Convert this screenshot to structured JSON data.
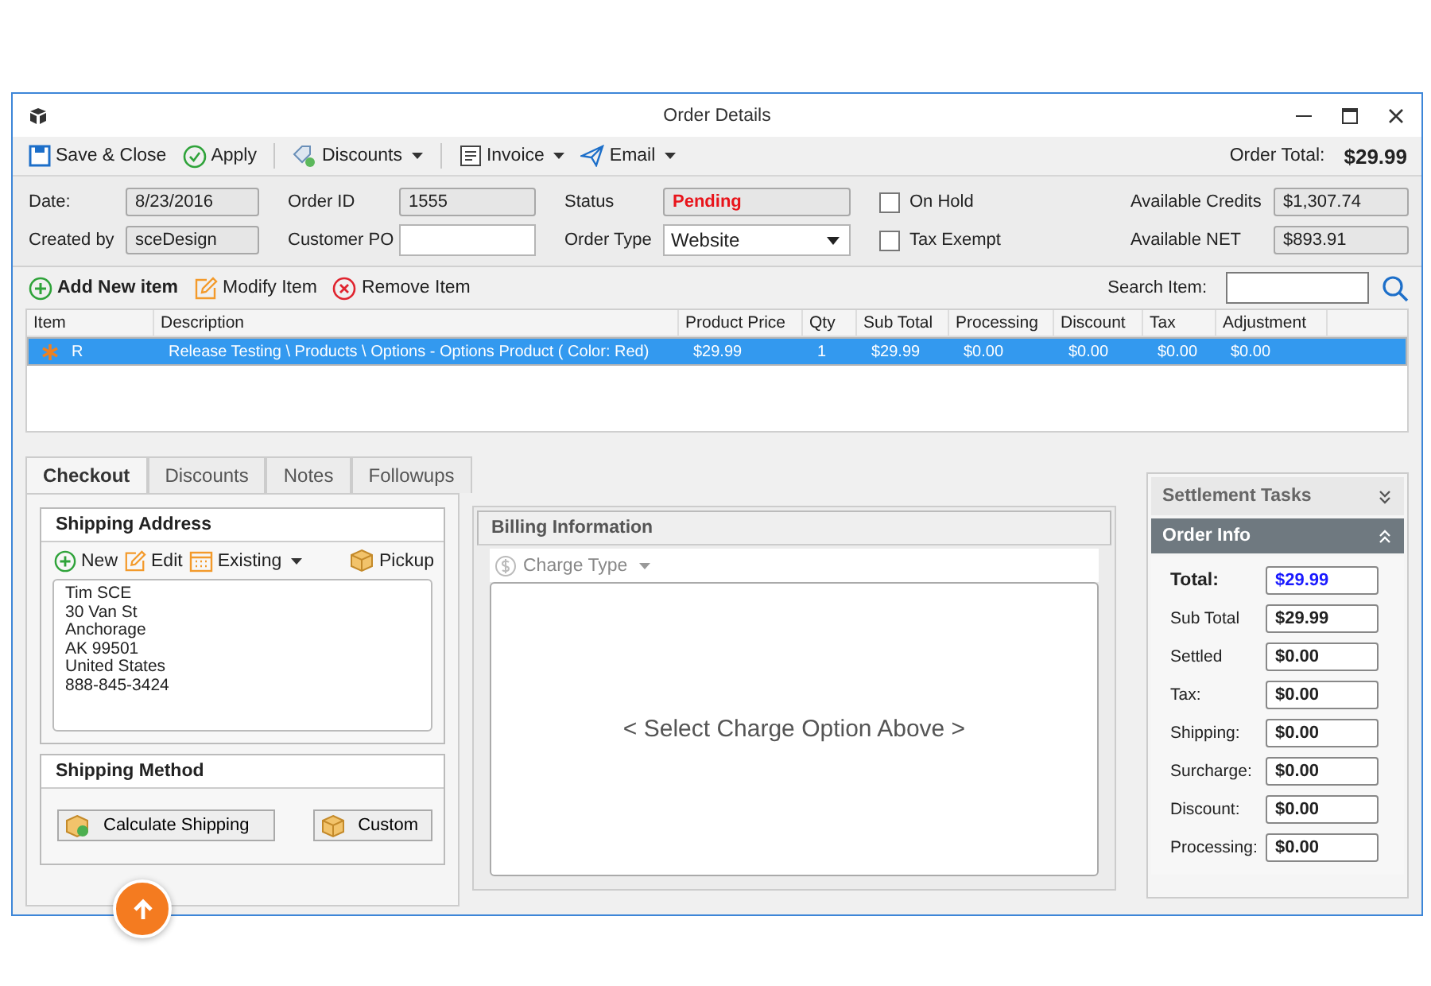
{
  "window": {
    "title": "Order Details"
  },
  "toolbar": {
    "save_close": "Save & Close",
    "apply": "Apply",
    "discounts": "Discounts",
    "invoice": "Invoice",
    "email": "Email",
    "order_total_label": "Order Total:",
    "order_total": "$29.99"
  },
  "header": {
    "date_label": "Date:",
    "date": "8/23/2016",
    "created_by_label": "Created by",
    "created_by": "sceDesign",
    "order_id_label": "Order ID",
    "order_id": "1555",
    "customer_po_label": "Customer PO",
    "status_label": "Status",
    "status": "Pending",
    "order_type_label": "Order Type",
    "order_type": "Website",
    "on_hold": {
      "label": "On Hold",
      "checked": false
    },
    "tax_exempt": {
      "label": "Tax Exempt",
      "checked": false
    },
    "credits_label": "Available Credits",
    "credits": "$1,307.74",
    "net_label": "Available NET",
    "net": "$893.91"
  },
  "items_toolbar": {
    "add": "Add New item",
    "modify": "Modify Item",
    "remove": "Remove Item",
    "search_label": "Search Item:"
  },
  "table": {
    "columns": [
      "Item",
      "Description",
      "Product Price",
      "Qty",
      "Sub Total",
      "Processing",
      "Discount",
      "Tax",
      "Adjustment"
    ],
    "rows": [
      {
        "selected": true,
        "cells": [
          "R",
          "Release Testing \\ Products \\ Options - Options Product ( Color: Red)",
          "$29.99",
          "1",
          "$29.99",
          "$0.00",
          "$0.00",
          "$0.00",
          "$0.00"
        ]
      }
    ]
  },
  "tabs": [
    {
      "label": "Checkout",
      "selected": true
    },
    {
      "label": "Discounts",
      "selected": false
    },
    {
      "label": "Notes",
      "selected": false
    },
    {
      "label": "Followups",
      "selected": false
    }
  ],
  "shipping_address": {
    "title": "Shipping Address",
    "new": "New",
    "edit": "Edit",
    "existing": "Existing",
    "pickup": "Pickup",
    "lines": [
      "Tim SCE",
      "30 Van St",
      "Anchorage",
      "AK 99501",
      "United States",
      "888-845-3424"
    ]
  },
  "shipping_method": {
    "title": "Shipping Method",
    "calculate": "Calculate Shipping",
    "custom": "Custom"
  },
  "billing": {
    "title": "Billing Information",
    "charge_type": "Charge Type",
    "message": "< Select Charge Option Above >"
  },
  "settlement_tasks": {
    "title": "Settlement Tasks",
    "expanded": false
  },
  "order_info": {
    "title": "Order Info",
    "expanded": true,
    "rows": [
      {
        "kind": "total",
        "label": "Total:",
        "value": "$29.99"
      },
      {
        "kind": "amount",
        "label": "Sub Total",
        "value": "$29.99"
      },
      {
        "kind": "amount",
        "label": "Settled",
        "value": "$0.00"
      },
      {
        "kind": "amount",
        "label": "Tax:",
        "value": "$0.00"
      },
      {
        "kind": "amount",
        "label": "Shipping:",
        "value": "$0.00"
      },
      {
        "kind": "amount",
        "label": "Surcharge:",
        "value": "$0.00"
      },
      {
        "kind": "amount",
        "label": "Discount:",
        "value": "$0.00"
      },
      {
        "kind": "amount",
        "label": "Processing:",
        "value": "$0.00"
      }
    ]
  }
}
